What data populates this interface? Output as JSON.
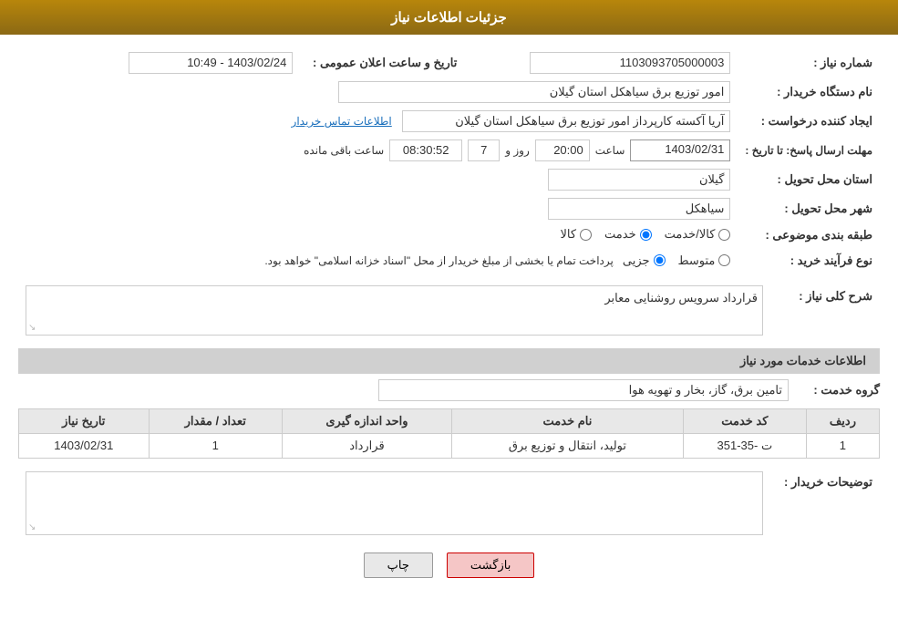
{
  "header": {
    "title": "جزئیات اطلاعات نیاز"
  },
  "fields": {
    "shomareNiaz_label": "شماره نیاز :",
    "shomareNiaz_value": "1103093705000003",
    "namDastgah_label": "نام دستگاه خریدار :",
    "namDastgah_value": "امور توزیع برق سیاهکل استان گیلان",
    "tarikh_label": "تاریخ و ساعت اعلان عمومی :",
    "tarikh_value": "1403/02/24 - 10:49",
    "ijad_label": "ایجاد کننده درخواست :",
    "ijad_value": "آریا آکسته کارپرداز امور توزیع برق سیاهکل استان گیلان",
    "contact_link": "اطلاعات تماس خریدار",
    "mohlat_label": "مهلت ارسال پاسخ: تا تاریخ :",
    "mohlat_date": "1403/02/31",
    "mohlat_saat_label": "ساعت",
    "mohlat_saat": "20:00",
    "mohlat_rooz_label": "روز و",
    "mohlat_rooz": "7",
    "mohlat_remaining_label": "ساعت باقی مانده",
    "mohlat_remaining": "08:30:52",
    "ostan_label": "استان محل تحویل :",
    "ostan_value": "گیلان",
    "shahr_label": "شهر محل تحویل :",
    "shahr_value": "سیاهکل",
    "tabaqe_label": "طبقه بندی موضوعی :",
    "tabaqe_options": [
      {
        "label": "کالا",
        "value": "kala"
      },
      {
        "label": "خدمت",
        "value": "khadamat"
      },
      {
        "label": "کالا/خدمت",
        "value": "kala_khadamat"
      }
    ],
    "tabaqe_selected": "khadamat",
    "noeFarayand_label": "نوع فرآیند خرید :",
    "noeFarayand_options": [
      {
        "label": "جزیی",
        "value": "jozi"
      },
      {
        "label": "متوسط",
        "value": "mottavaset"
      }
    ],
    "noeFarayand_selected": "jozi",
    "noeFarayand_note": "پرداخت تمام یا بخشی از مبلغ خریدار از محل \"اسناد خزانه اسلامی\" خواهد بود.",
    "sharh_label": "شرح کلی نیاز :",
    "sharh_value": "قرارداد سرویس روشنایی معابر",
    "services_section": "اطلاعات خدمات مورد نیاز",
    "group_label": "گروه خدمت :",
    "group_value": "تامین برق، گاز، بخار و تهویه هوا",
    "table_headers": [
      "ردیف",
      "کد خدمت",
      "نام خدمت",
      "واحد اندازه گیری",
      "تعداد / مقدار",
      "تاریخ نیاز"
    ],
    "table_rows": [
      {
        "radif": "1",
        "code": "ت -35-351",
        "name": "تولید، انتقال و توزیع برق",
        "unit": "قرارداد",
        "count": "1",
        "date": "1403/02/31"
      }
    ],
    "description_label": "توضیحات خریدار :",
    "description_value": ""
  },
  "buttons": {
    "print_label": "چاپ",
    "back_label": "بازگشت"
  }
}
